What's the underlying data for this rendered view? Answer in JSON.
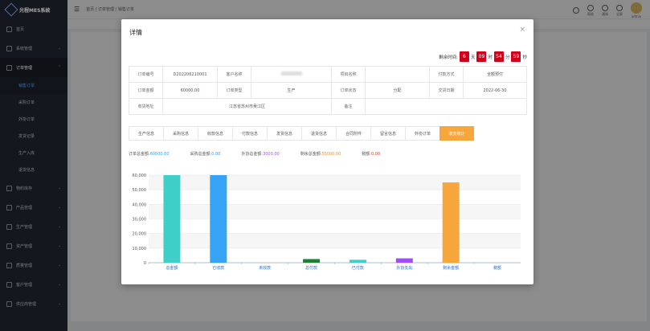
{
  "app": {
    "name": "光程MES系统"
  },
  "sidebar": {
    "items": [
      {
        "label": "首页",
        "expanded": false
      },
      {
        "label": "系统管理",
        "expanded": false
      },
      {
        "label": "订单管理",
        "expanded": true
      },
      {
        "label": "物料库存",
        "expanded": false
      },
      {
        "label": "产品管理",
        "expanded": false
      },
      {
        "label": "生产管理",
        "expanded": false
      },
      {
        "label": "资产管理",
        "expanded": false
      },
      {
        "label": "质量管理",
        "expanded": false
      },
      {
        "label": "客户管理",
        "expanded": false
      },
      {
        "label": "供应商管理",
        "expanded": false
      }
    ],
    "subitems": [
      {
        "label": "销售订单",
        "active": true
      },
      {
        "label": "采购订单",
        "active": false
      },
      {
        "label": "外协订单",
        "active": false
      },
      {
        "label": "发货记录",
        "active": false
      },
      {
        "label": "生产入库",
        "active": false
      },
      {
        "label": "退货信息",
        "active": false
      }
    ]
  },
  "topbar": {
    "breadcrumb": "首页 / 订单管理 / 销售订单",
    "icons": [
      {
        "name": "search-icon",
        "label": ""
      },
      {
        "name": "help-icon",
        "label": "帮助"
      },
      {
        "name": "bell-icon",
        "label": "通知"
      },
      {
        "name": "fullscreen-icon",
        "label": "全屏"
      }
    ],
    "user": "admin"
  },
  "modal": {
    "title": "详情",
    "close": "×",
    "countdown": {
      "prefix": "剩余时间:",
      "days": "6",
      "day_unit": "天",
      "hours": "09",
      "hour_unit": "时",
      "minutes": "54",
      "minute_unit": "分",
      "seconds": "59",
      "second_unit": "秒"
    },
    "info": {
      "order_no_label": "订单编号",
      "order_no": "D202206210001",
      "customer_label": "客户名称",
      "project_label": "项目名称",
      "project": "",
      "pay_label": "付款方式",
      "pay": "全额预付",
      "amount_label": "订单金额",
      "amount": "60000.00",
      "type_label": "订单类型",
      "type": "生产",
      "status_label": "订单状态",
      "status": "分配",
      "delivery_label": "交货日期",
      "delivery": "2022-06-30",
      "address_label": "收货地址",
      "address": "江苏省苏州市吴江区",
      "remark_label": "备注",
      "remark": ""
    },
    "tabs": [
      {
        "label": "生产信息",
        "active": false
      },
      {
        "label": "采购信息",
        "active": false
      },
      {
        "label": "收款信息",
        "active": false
      },
      {
        "label": "付款信息",
        "active": false
      },
      {
        "label": "发货信息",
        "active": false
      },
      {
        "label": "退货信息",
        "active": false
      },
      {
        "label": "合同附件",
        "active": false
      },
      {
        "label": "留言信息",
        "active": false
      },
      {
        "label": "外协订单",
        "active": false
      },
      {
        "label": "收支统计",
        "active": true
      }
    ],
    "stats": [
      {
        "label": "订单总金额:",
        "value": "60000.00"
      },
      {
        "label": "采购总金额:",
        "value": "0.00"
      },
      {
        "label": "外协总金额:",
        "value": "3000.00"
      },
      {
        "label": "剩余总金额:",
        "value": "55000.00"
      },
      {
        "label": "税额:",
        "value": "0.00"
      }
    ]
  },
  "chart_data": {
    "type": "bar",
    "categories": [
      "总金额",
      "已收款",
      "未收款",
      "总付款",
      "已付款",
      "外协支出",
      "剩余金额",
      "税额"
    ],
    "values": [
      60000,
      60000,
      0,
      2500,
      2000,
      3000,
      55000,
      0
    ],
    "colors": [
      "#3fcfc9",
      "#36a3f7",
      "#36a3f7",
      "#1e7e34",
      "#3fcfc9",
      "#a24cf5",
      "#f7a63c",
      "#3fcfc9"
    ],
    "ylim": [
      0,
      60000
    ],
    "yticks": [
      "0",
      "10,000",
      "20,000",
      "30,000",
      "40,000",
      "50,000",
      "60,000"
    ],
    "grid": true
  }
}
